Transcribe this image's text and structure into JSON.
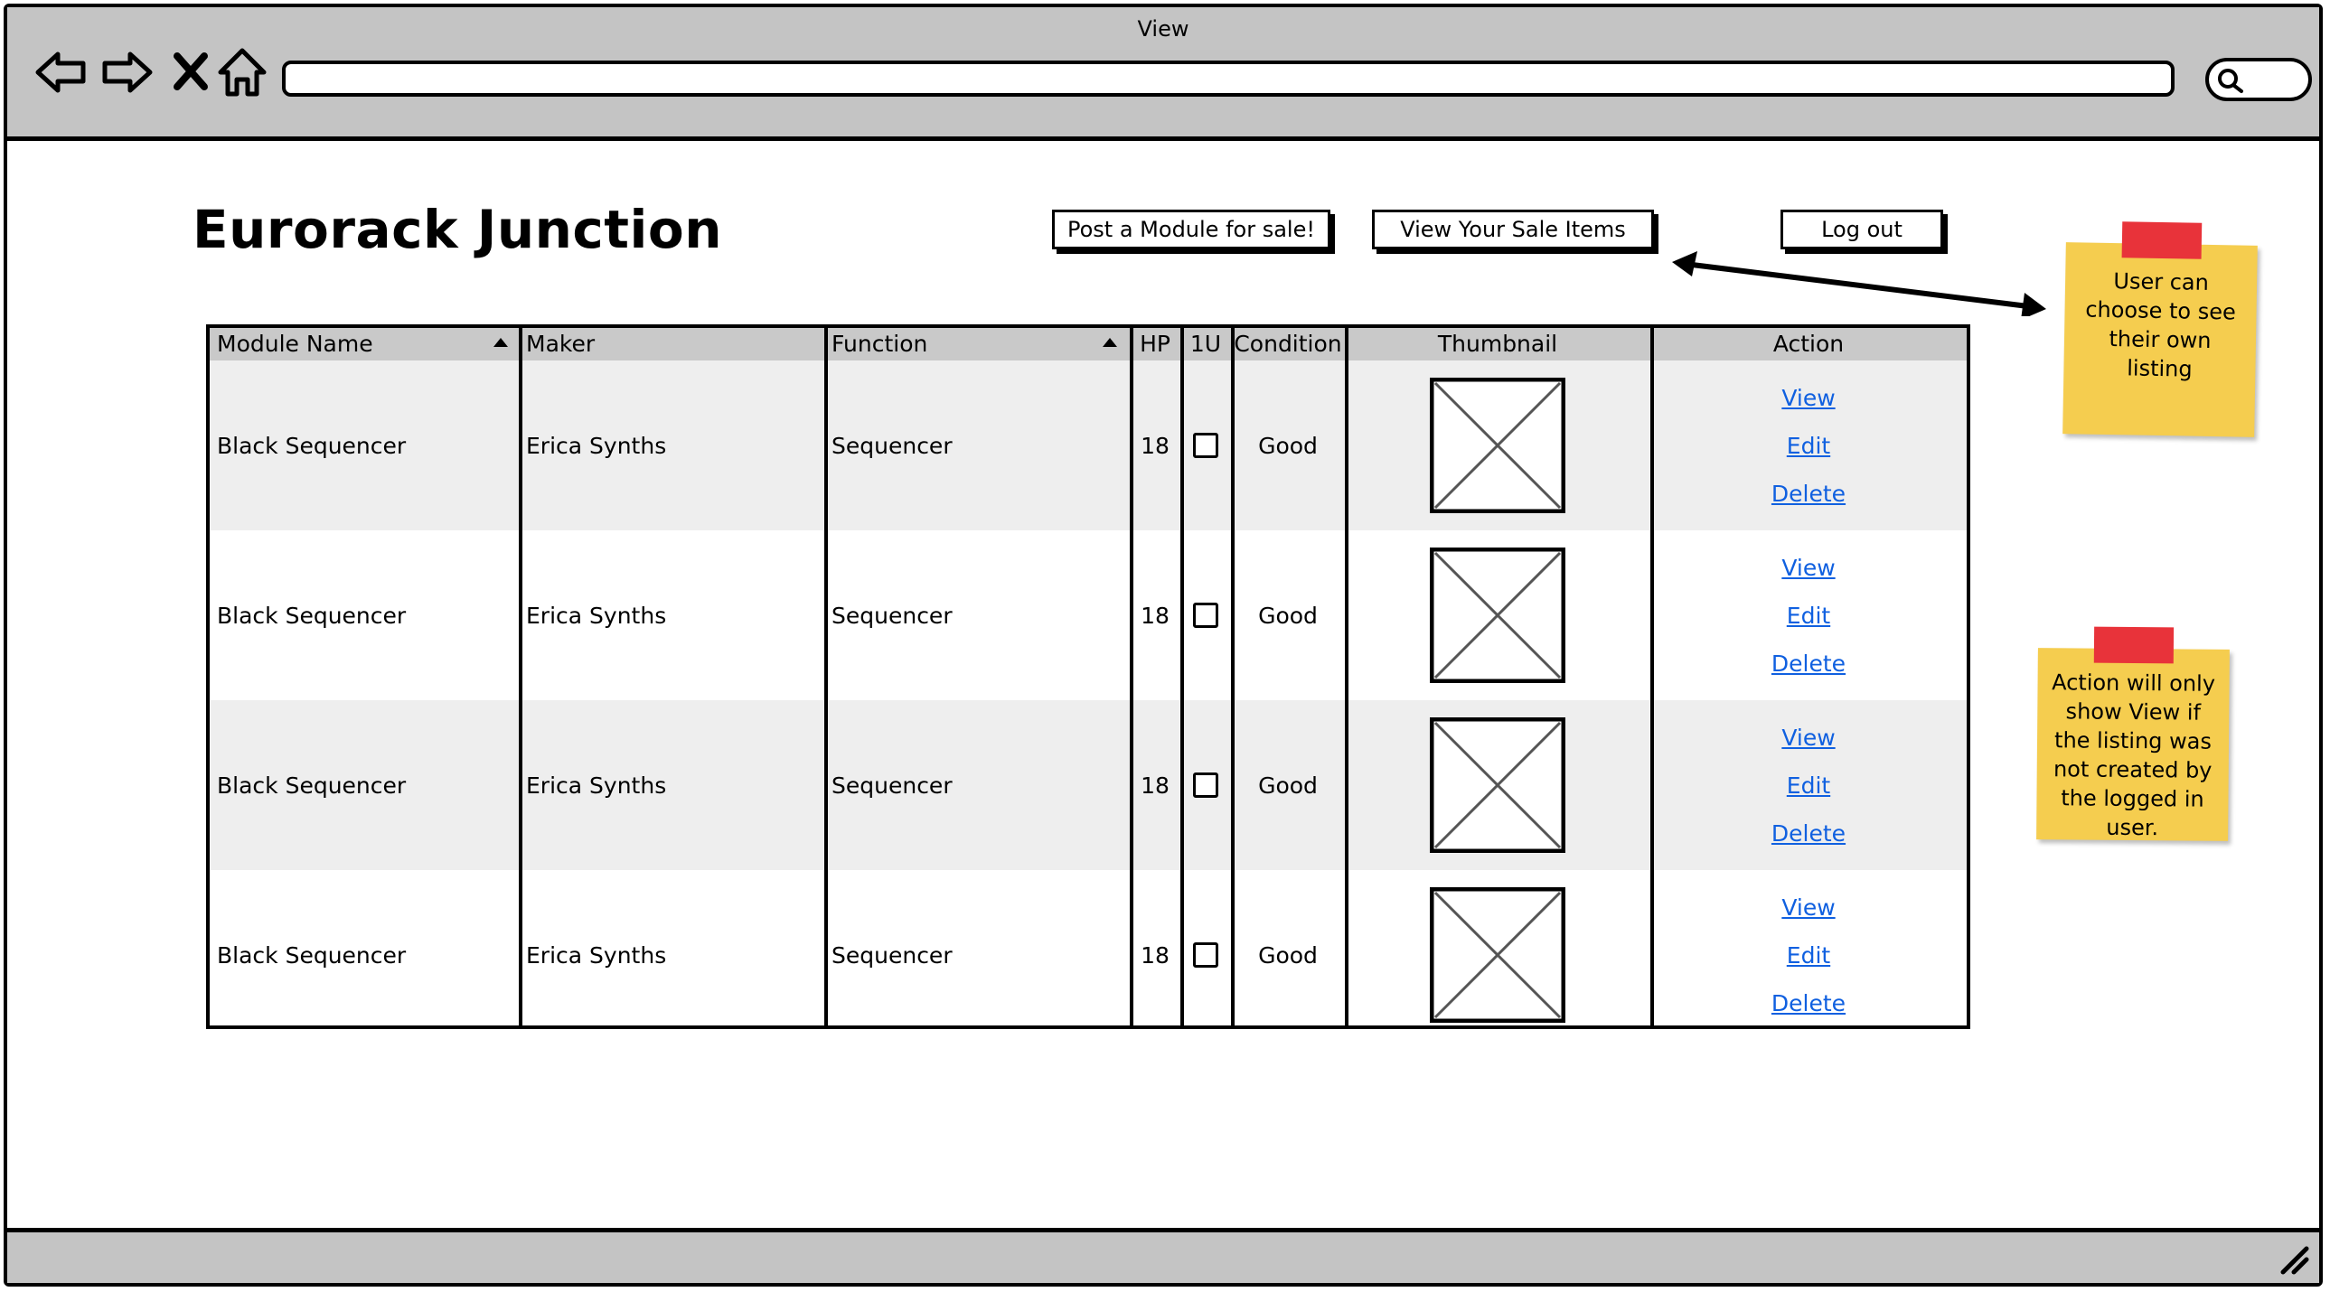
{
  "window": {
    "title": "View"
  },
  "app": {
    "title": "Eurorack Junction"
  },
  "header_buttons": {
    "post": "Post a Module for sale!",
    "view_sale": "View Your Sale Items",
    "logout": "Log out"
  },
  "table": {
    "columns": [
      "Module Name",
      "Maker",
      "Function",
      "HP",
      "1U",
      "Condition",
      "Thumbnail",
      "Action"
    ],
    "rows": [
      {
        "module_name": "Black Sequencer",
        "maker": "Erica Synths",
        "function": "Sequencer",
        "hp": "18",
        "one_u": false,
        "condition": "Good",
        "actions": [
          "View",
          "Edit",
          "Delete"
        ]
      },
      {
        "module_name": "Black Sequencer",
        "maker": "Erica Synths",
        "function": "Sequencer",
        "hp": "18",
        "one_u": false,
        "condition": "Good",
        "actions": [
          "View",
          "Edit",
          "Delete"
        ]
      },
      {
        "module_name": "Black Sequencer",
        "maker": "Erica Synths",
        "function": "Sequencer",
        "hp": "18",
        "one_u": false,
        "condition": "Good",
        "actions": [
          "View",
          "Edit",
          "Delete"
        ]
      },
      {
        "module_name": "Black Sequencer",
        "maker": "Erica Synths",
        "function": "Sequencer",
        "hp": "18",
        "one_u": false,
        "condition": "Good",
        "actions": [
          "View",
          "Edit",
          "Delete"
        ]
      }
    ]
  },
  "notes": {
    "note1": "User can choose to see their own listing",
    "note2": "Action will only show View if the listing was not created by the logged in user."
  },
  "colors": {
    "link": "#1060e0",
    "sticky": "#f5cd4f",
    "tape": "#e8333a",
    "chrome": "#c4c4c4"
  }
}
